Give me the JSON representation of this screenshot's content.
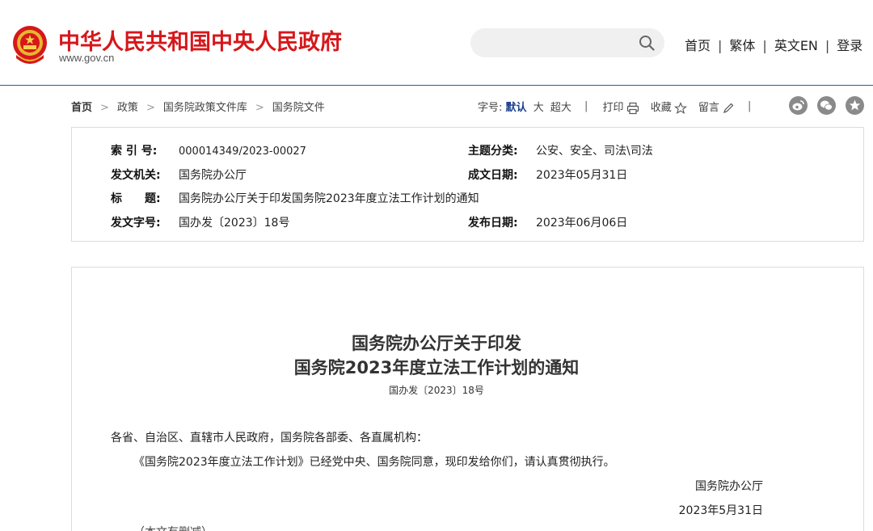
{
  "header": {
    "site_title": "中华人民共和国中央人民政府",
    "site_domain": "www.gov.cn",
    "search": {
      "placeholder": ""
    },
    "nav": [
      "首页",
      "繁体",
      "英文EN",
      "登录"
    ],
    "nav_separator": "|"
  },
  "breadcrumb": {
    "items": [
      "首页",
      "政策",
      "国务院政策文件库",
      "国务院文件"
    ],
    "arrow": ">"
  },
  "tools": {
    "font_size_label": "字号:",
    "font_default": "默认",
    "font_large": "大",
    "font_xlarge": "超大",
    "divider": "|",
    "print": "打印",
    "favorite": "收藏",
    "comment": "留言"
  },
  "info": {
    "index_label": "索 引 号:",
    "index_value": "000014349/2023-00027",
    "topic_label": "主题分类:",
    "topic_value": "公安、安全、司法\\司法",
    "issuer_label": "发文机关:",
    "issuer_value": "国务院办公厅",
    "created_label": "成文日期:",
    "created_value": "2023年05月31日",
    "title_label": "标　　题:",
    "title_value": "国务院办公厅关于印发国务院2023年度立法工作计划的通知",
    "docno_label": "发文字号:",
    "docno_value": "国办发〔2023〕18号",
    "published_label": "发布日期:",
    "published_value": "2023年06月06日"
  },
  "document": {
    "title_line1": "国务院办公厅关于印发",
    "title_line2": "国务院2023年度立法工作计划的通知",
    "number": "国办发〔2023〕18号",
    "salutation": "各省、自治区、直辖市人民政府，国务院各部委、各直属机构：",
    "body": "《国务院2023年度立法工作计划》已经党中央、国务院同意，现印发给你们，请认真贯彻执行。",
    "signature": "国务院办公厅",
    "date": "2023年5月31日",
    "note": "（本文有删减）"
  },
  "colors": {
    "brand_red": "#d6171b",
    "header_border": "#1f5f9c",
    "active_font": "#1a3e8c",
    "share_icon": "#8a8a8a"
  },
  "icons": [
    "national-emblem-icon",
    "search-icon",
    "printer-icon",
    "star-icon",
    "pencil-icon",
    "weibo-icon",
    "wechat-icon",
    "favorite-circle-icon"
  ]
}
